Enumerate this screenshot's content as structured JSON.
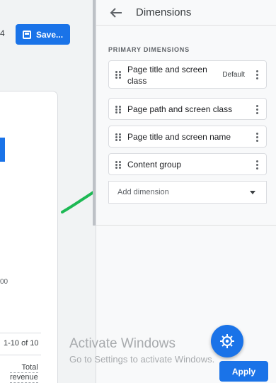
{
  "left": {
    "partial_number": "4",
    "save_label": "Save...",
    "axis_tick": "00",
    "pagination": "1-10 of 10",
    "total_line1": "Total",
    "total_line2": "revenue"
  },
  "panel": {
    "title": "Dimensions",
    "section_label": "PRIMARY DIMENSIONS",
    "items": [
      {
        "label": "Page title and screen class",
        "tag": "Default"
      },
      {
        "label": "Page path and screen class",
        "tag": ""
      },
      {
        "label": "Page title and screen name",
        "tag": ""
      },
      {
        "label": "Content group",
        "tag": ""
      }
    ],
    "add_placeholder": "Add dimension",
    "apply_label": "Apply"
  },
  "watermark": {
    "line1": "Activate Windows",
    "line2": "Go to Settings to activate Windows."
  },
  "colors": {
    "accent": "#1a73e8",
    "annotation_arrow": "#1db954"
  },
  "icons": [
    "save-icon",
    "back-arrow-icon",
    "drag-handle-icon",
    "more-vert-icon",
    "dropdown-caret-icon",
    "insights-icon"
  ]
}
